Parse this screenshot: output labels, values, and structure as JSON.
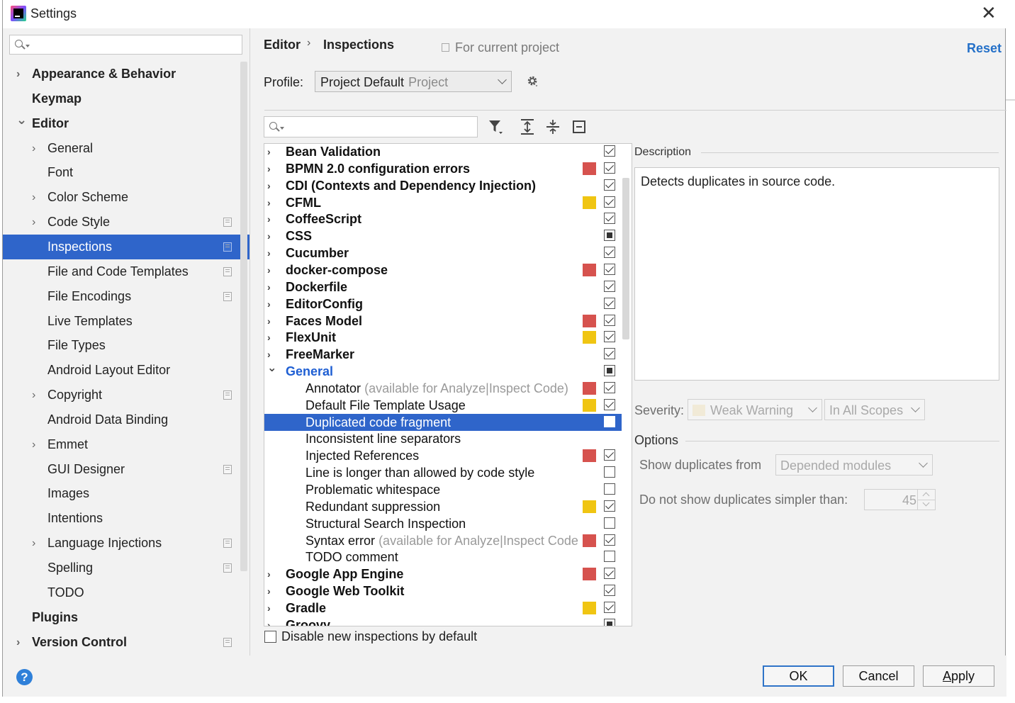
{
  "window": {
    "title": "Settings",
    "close_glyph": "✕"
  },
  "sidebar": {
    "search": {
      "placeholder": "",
      "icon": "search-icon"
    },
    "items": [
      {
        "label": "Appearance & Behavior",
        "expandable": true,
        "bold": true,
        "level": 0
      },
      {
        "label": "Keymap",
        "expandable": false,
        "bold": true,
        "level": 0
      },
      {
        "label": "Editor",
        "expanded": true,
        "bold": true,
        "level": 0
      },
      {
        "label": "General",
        "expandable": true,
        "level": 1
      },
      {
        "label": "Font",
        "level": 1
      },
      {
        "label": "Color Scheme",
        "expandable": true,
        "level": 1
      },
      {
        "label": "Code Style",
        "expandable": true,
        "level": 1,
        "project_icon": true
      },
      {
        "label": "Inspections",
        "level": 1,
        "project_icon": true,
        "selected": true
      },
      {
        "label": "File and Code Templates",
        "level": 1,
        "project_icon": true
      },
      {
        "label": "File Encodings",
        "level": 1,
        "project_icon": true
      },
      {
        "label": "Live Templates",
        "level": 1
      },
      {
        "label": "File Types",
        "level": 1
      },
      {
        "label": "Android Layout Editor",
        "level": 1
      },
      {
        "label": "Copyright",
        "expandable": true,
        "level": 1,
        "project_icon": true
      },
      {
        "label": "Android Data Binding",
        "level": 1
      },
      {
        "label": "Emmet",
        "expandable": true,
        "level": 1
      },
      {
        "label": "GUI Designer",
        "level": 1,
        "project_icon": true
      },
      {
        "label": "Images",
        "level": 1
      },
      {
        "label": "Intentions",
        "level": 1
      },
      {
        "label": "Language Injections",
        "expandable": true,
        "level": 1,
        "project_icon": true
      },
      {
        "label": "Spelling",
        "level": 1,
        "project_icon": true
      },
      {
        "label": "TODO",
        "level": 1
      },
      {
        "label": "Plugins",
        "bold": true,
        "level": 0
      },
      {
        "label": "Version Control",
        "expandable": true,
        "bold": true,
        "level": 0,
        "project_icon": true
      }
    ]
  },
  "header": {
    "breadcrumb": [
      "Editor",
      "Inspections"
    ],
    "scope_note": "For current project",
    "reset_label": "Reset"
  },
  "profile": {
    "label": "Profile:",
    "value": "Project Default",
    "value_suffix": "Project"
  },
  "inspections": {
    "search_placeholder": "",
    "rows": [
      {
        "label": "Bean Validation",
        "group": true,
        "severity": null,
        "check": "checked"
      },
      {
        "label": "BPMN 2.0 configuration errors",
        "group": true,
        "severity": "error",
        "check": "checked"
      },
      {
        "label": "CDI (Contexts and Dependency Injection)",
        "group": true,
        "severity": null,
        "check": "checked"
      },
      {
        "label": "CFML",
        "group": true,
        "severity": "warning",
        "check": "checked"
      },
      {
        "label": "CoffeeScript",
        "group": true,
        "severity": null,
        "check": "checked"
      },
      {
        "label": "CSS",
        "group": true,
        "severity": null,
        "check": "partial"
      },
      {
        "label": "Cucumber",
        "group": true,
        "severity": null,
        "check": "checked"
      },
      {
        "label": "docker-compose",
        "group": true,
        "severity": "error",
        "check": "checked"
      },
      {
        "label": "Dockerfile",
        "group": true,
        "severity": null,
        "check": "checked"
      },
      {
        "label": "EditorConfig",
        "group": true,
        "severity": null,
        "check": "checked"
      },
      {
        "label": "Faces Model",
        "group": true,
        "severity": "error",
        "check": "checked"
      },
      {
        "label": "FlexUnit",
        "group": true,
        "severity": "warning",
        "check": "checked"
      },
      {
        "label": "FreeMarker",
        "group": true,
        "severity": null,
        "check": "checked"
      },
      {
        "label": "General",
        "group": true,
        "expanded": true,
        "blue": true,
        "severity": null,
        "check": "partial"
      },
      {
        "label": "Annotator",
        "sub": "(available for Analyze|Inspect Code)",
        "severity": "error",
        "check": "checked"
      },
      {
        "label": "Default File Template Usage",
        "severity": "warning",
        "check": "checked"
      },
      {
        "label": "Duplicated code fragment",
        "severity": null,
        "check": "unchecked",
        "selected": true
      },
      {
        "label": "Inconsistent line separators",
        "severity": null,
        "check": "none"
      },
      {
        "label": "Injected References",
        "severity": "error",
        "check": "checked"
      },
      {
        "label": "Line is longer than allowed by code style",
        "severity": null,
        "check": "unchecked"
      },
      {
        "label": "Problematic whitespace",
        "severity": null,
        "check": "unchecked"
      },
      {
        "label": "Redundant suppression",
        "severity": "warning",
        "check": "checked"
      },
      {
        "label": "Structural Search Inspection",
        "severity": null,
        "check": "unchecked"
      },
      {
        "label": "Syntax error",
        "sub": "(available for Analyze|Inspect Code",
        "severity": "error",
        "check": "checked"
      },
      {
        "label": "TODO comment",
        "severity": null,
        "check": "unchecked"
      },
      {
        "label": "Google App Engine",
        "group": true,
        "severity": "error",
        "check": "checked"
      },
      {
        "label": "Google Web Toolkit",
        "group": true,
        "severity": null,
        "check": "checked"
      },
      {
        "label": "Gradle",
        "group": true,
        "severity": "warning",
        "check": "checked"
      },
      {
        "label": "Groovy",
        "group": true,
        "severity": null,
        "check": "partial"
      }
    ],
    "disable_new_label": "Disable new inspections by default"
  },
  "description": {
    "title": "Description",
    "text": "Detects duplicates in source code."
  },
  "severity": {
    "label": "Severity:",
    "value": "Weak Warning",
    "scope": "In All Scopes"
  },
  "options": {
    "title": "Options",
    "show_from_label": "Show duplicates from",
    "show_from_value": "Depended modules",
    "simpler_label": "Do not show duplicates simpler than:",
    "simpler_value": "45"
  },
  "footer": {
    "ok": "OK",
    "cancel": "Cancel",
    "apply_prefix": "A",
    "apply_rest": "pply",
    "help_glyph": "?"
  },
  "colors": {
    "selection": "#2f65ca",
    "error": "#d6524e",
    "warning": "#f0c512",
    "link": "#2470c8"
  }
}
